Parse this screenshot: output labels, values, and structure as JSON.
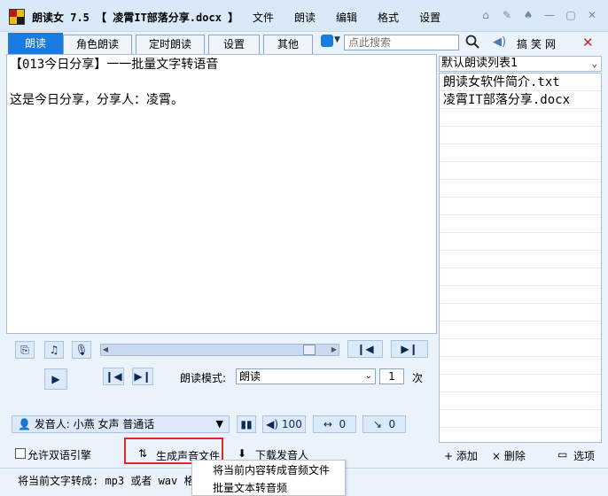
{
  "window": {
    "app_title": "朗读女 7.5 【 凌霄IT部落分享.docx 】",
    "menu": [
      "文件",
      "朗读",
      "编辑",
      "格式",
      "设置"
    ]
  },
  "tabs": [
    "朗读",
    "角色朗读",
    "定时朗读",
    "设置",
    "其他"
  ],
  "search": {
    "placeholder": "点此搜索"
  },
  "toolbar_right": {
    "fun_text": "搞笑网"
  },
  "editor": {
    "line1": "【013今日分享】一一批量文字转语音",
    "line2": "这是今日分享，分享人：凌霄。"
  },
  "playlist": {
    "selected": "默认朗读列表1",
    "items": [
      "朗读女软件简介.txt",
      "凌霄IT部落分享.docx"
    ],
    "add_label": "+ 添加",
    "delete_label": "× 删除",
    "options_label": "选项"
  },
  "controls": {
    "mode_label": "朗读模式:",
    "mode_value": "朗读",
    "times_value": "1",
    "times_unit": "次",
    "voice": "发音人: 小燕 女声 普通话",
    "volume": "100",
    "speed": "0",
    "pitch": "0",
    "allow_dual_engine": "允许双语引擎",
    "generate_audio": "生成声音文件",
    "download_voice": "下载发音人",
    "position_percent": 92
  },
  "status": {
    "text": "将当前文字转成: mp3 或者 wav 格式"
  },
  "popup_menu": [
    "将当前内容转成音频文件",
    "批量文本转音频"
  ],
  "colors": {
    "accent": "#1a7be0",
    "highlight_border": "#e02a2a",
    "close": "#d0232a"
  }
}
